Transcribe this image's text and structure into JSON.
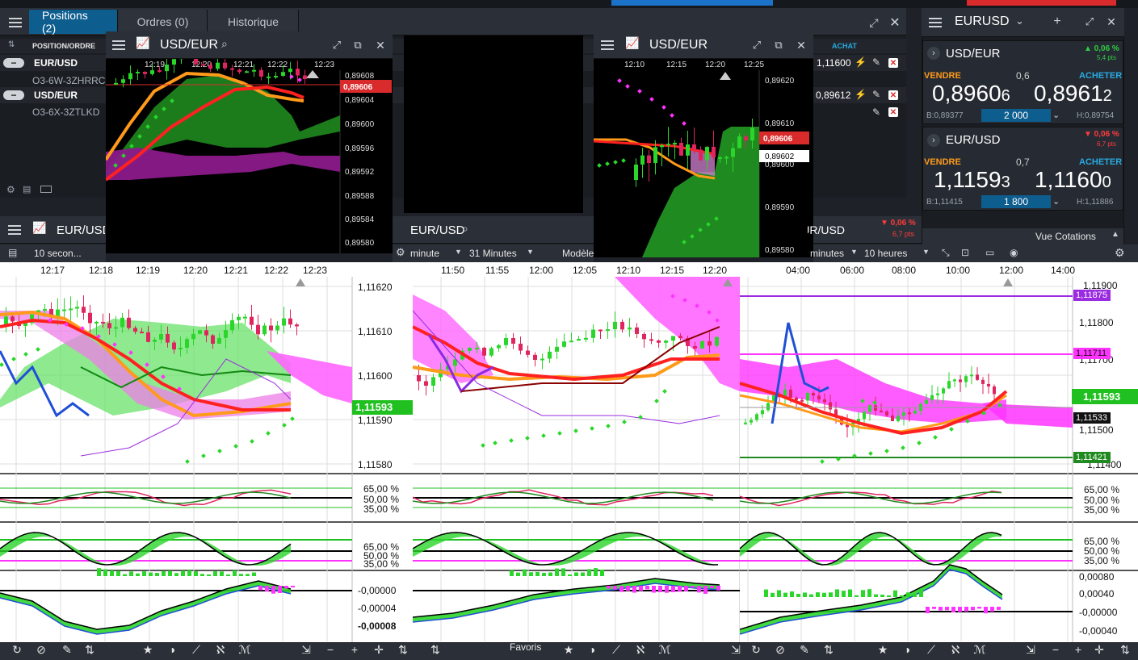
{
  "top_tabs": {
    "positions": "Positions (2)",
    "orders": "Ordres (0)",
    "history": "Historique"
  },
  "positions": {
    "col_header": "POSITION/ORDRE",
    "buy_header": "ACHAT",
    "rows": [
      {
        "symbol": "EUR/USD",
        "order": "O3-6W-3ZHRRC",
        "price": "1,11600"
      },
      {
        "symbol": "USD/EUR",
        "order": "O3-6X-3ZTLKD",
        "price": "0,89612"
      }
    ]
  },
  "float_left": {
    "title": "USD/EUR",
    "times": [
      "12:19",
      "12:20",
      "12:21",
      "12:22",
      "12:23"
    ],
    "prices": [
      "0,89608",
      "0,89604",
      "0,89600",
      "0,89596",
      "0,89592",
      "0,89588",
      "0,89584",
      "0,89580"
    ],
    "current": "0,89606"
  },
  "float_right": {
    "title": "USD/EUR",
    "times": [
      "12:10",
      "12:15",
      "12:20",
      "12:25"
    ],
    "prices": [
      "0,89620",
      "0,89610",
      "0,89600",
      "0,89590",
      "0,89580"
    ],
    "current": "0,89606",
    "current2": "0,89602"
  },
  "quotes": {
    "header": "EURUSD",
    "cards": [
      {
        "pair": "USD/EUR",
        "change": "▲ 0,06 %",
        "change_pts": "5,4 pts",
        "change_color": "#2ecc40",
        "sell_label": "VENDRE",
        "buy_label": "ACHETER",
        "spread": "0,6",
        "sell_main": "0,8960",
        "sell_small": "6",
        "buy_main": "0,8961",
        "buy_small": "2",
        "low": "B:0,89377",
        "qty": "2 000",
        "high": "H:0,89754"
      },
      {
        "pair": "EUR/USD",
        "change": "▼ 0,06 %",
        "change_pts": "6,7 pts",
        "change_color": "#ff3b3b",
        "sell_label": "VENDRE",
        "buy_label": "ACHETER",
        "spread": "0,7",
        "sell_main": "1,1159",
        "sell_small": "3",
        "buy_main": "1,1160",
        "buy_small": "0",
        "low": "B:1,11415",
        "qty": "1 800",
        "high": "H:1,11886"
      }
    ],
    "footer": "Vue Cotations"
  },
  "chart1": {
    "title": "EUR/USD",
    "interval": "10 secon...",
    "times": [
      "12:17",
      "12:18",
      "12:19",
      "12:20",
      "12:21",
      "12:22",
      "12:23"
    ],
    "prices": [
      "1,11620",
      "1,11610",
      "1,11600",
      "1,11590",
      "1,11580"
    ],
    "current": "1,11593",
    "osc1": [
      "65,00 %",
      "50,00 %",
      "35,00 %"
    ],
    "osc2": [
      "65,00 %",
      "50,00 %",
      "35,00 %"
    ],
    "macd": [
      "-0,00000",
      "-0,00004",
      "-0,00008"
    ]
  },
  "chart2": {
    "title": "EUR/USD",
    "interval_a": "minute",
    "interval_b": "31 Minutes",
    "model": "Modèle",
    "times": [
      "11:50",
      "11:55",
      "12:00",
      "12:05",
      "12:10",
      "12:15",
      "12:20"
    ],
    "favorites": "Favoris"
  },
  "chart3": {
    "title": "EUR/USD",
    "change": "▼ 0,06 %",
    "change_pts": "6,7 pts",
    "interval_a": "minutes",
    "interval_b": "10 heures",
    "times": [
      "04:00",
      "06:00",
      "08:00",
      "10:00",
      "12:00",
      "14:00"
    ],
    "prices": [
      "1,11900",
      "1,11800",
      "1,11700",
      "1,11600",
      "1,11500",
      "1,11400"
    ],
    "current": "1,11593",
    "marker_purple": "1,11875",
    "marker_magenta": "1,11711",
    "marker_black": "1,11533",
    "marker_green": "1,11421",
    "osc1": [
      "65,00 %",
      "50,00 %",
      "35,00 %"
    ],
    "osc2": [
      "65,00 %",
      "50,00 %",
      "35,00 %"
    ],
    "macd": [
      "0,00080",
      "0,00040",
      "-0,00000",
      "-0,00040"
    ]
  }
}
